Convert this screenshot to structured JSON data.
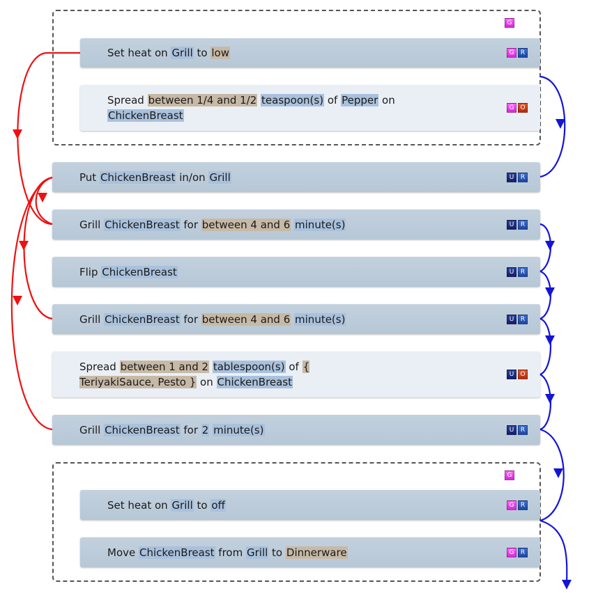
{
  "groups": [
    {
      "badges": [
        "G"
      ]
    },
    {
      "badges": [
        "G"
      ]
    }
  ],
  "steps": [
    {
      "tokens": [
        {
          "t": "Set heat on "
        },
        {
          "t": "Grill",
          "k": "obj"
        },
        {
          "t": " to "
        },
        {
          "t": "low",
          "k": "val"
        }
      ],
      "badges": [
        "G",
        "R"
      ]
    },
    {
      "tokens": [
        {
          "t": "Spread "
        },
        {
          "t": "between 1/4 and 1/2",
          "k": "val"
        },
        {
          "t": " "
        },
        {
          "t": "teaspoon(s)",
          "k": "obj"
        },
        {
          "t": " of "
        },
        {
          "t": "Pepper",
          "k": "obj"
        },
        {
          "t": " on "
        },
        {
          "t": "ChickenBreast",
          "k": "obj"
        }
      ],
      "badges": [
        "G",
        "O"
      ]
    },
    {
      "tokens": [
        {
          "t": "Put "
        },
        {
          "t": "ChickenBreast",
          "k": "obj"
        },
        {
          "t": " in/on "
        },
        {
          "t": "Grill",
          "k": "obj"
        }
      ],
      "badges": [
        "U",
        "R"
      ]
    },
    {
      "tokens": [
        {
          "t": "Grill "
        },
        {
          "t": "ChickenBreast",
          "k": "obj"
        },
        {
          "t": " for "
        },
        {
          "t": "between 4 and 6",
          "k": "val"
        },
        {
          "t": " "
        },
        {
          "t": "minute(s)",
          "k": "obj"
        }
      ],
      "badges": [
        "U",
        "R"
      ]
    },
    {
      "tokens": [
        {
          "t": "Flip "
        },
        {
          "t": "ChickenBreast",
          "k": "obj"
        }
      ],
      "badges": [
        "U",
        "R"
      ]
    },
    {
      "tokens": [
        {
          "t": "Grill "
        },
        {
          "t": "ChickenBreast",
          "k": "obj"
        },
        {
          "t": " for "
        },
        {
          "t": "between 4 and 6",
          "k": "val"
        },
        {
          "t": " "
        },
        {
          "t": "minute(s)",
          "k": "obj"
        }
      ],
      "badges": [
        "U",
        "R"
      ]
    },
    {
      "tokens": [
        {
          "t": "Spread "
        },
        {
          "t": "between 1 and 2",
          "k": "val"
        },
        {
          "t": " "
        },
        {
          "t": "tablespoon(s)",
          "k": "obj"
        },
        {
          "t": " of "
        },
        {
          "t": "{ TeriyakiSauce, Pesto }",
          "k": "val"
        },
        {
          "t": " on "
        },
        {
          "t": "ChickenBreast",
          "k": "obj"
        }
      ],
      "badges": [
        "U",
        "O"
      ]
    },
    {
      "tokens": [
        {
          "t": "Grill "
        },
        {
          "t": "ChickenBreast",
          "k": "obj"
        },
        {
          "t": " for "
        },
        {
          "t": "2",
          "k": "obj"
        },
        {
          "t": " "
        },
        {
          "t": "minute(s)",
          "k": "obj"
        }
      ],
      "badges": [
        "U",
        "R"
      ]
    },
    {
      "tokens": [
        {
          "t": "Set heat on "
        },
        {
          "t": "Grill",
          "k": "obj"
        },
        {
          "t": " to "
        },
        {
          "t": "off",
          "k": "obj"
        }
      ],
      "badges": [
        "G",
        "R"
      ]
    },
    {
      "tokens": [
        {
          "t": "Move "
        },
        {
          "t": "ChickenBreast",
          "k": "obj"
        },
        {
          "t": " from "
        },
        {
          "t": "Grill",
          "k": "obj"
        },
        {
          "t": " to "
        },
        {
          "t": "Dinnerware",
          "k": "val"
        }
      ],
      "badges": [
        "G",
        "R"
      ]
    }
  ],
  "colors": {
    "dependency_arrow": "#ee1111",
    "sequence_arrow": "#1414d6"
  },
  "icons": [
    "arrowhead-icon"
  ]
}
